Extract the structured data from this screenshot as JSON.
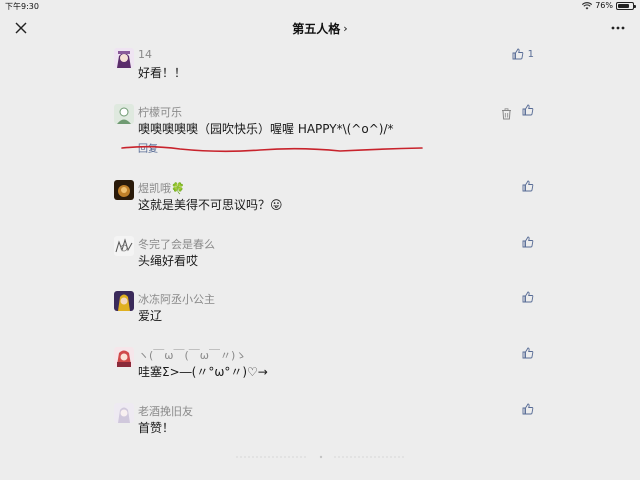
{
  "status": {
    "time": "下午9:30",
    "battery": "76%",
    "battery_level": 0.76
  },
  "nav": {
    "title": "第五人格",
    "chevron": "›",
    "close_icon": "close-icon",
    "more_icon": "more-icon"
  },
  "comments": [
    {
      "name": "14",
      "text": "好看！！",
      "likes": "1",
      "avatar_color": "#8a5a9a"
    },
    {
      "name": "柠檬可乐",
      "text": "噢噢噢噢噢（园吹快乐）喔喔 HAPPY*\\(^o^)/*",
      "reply": "回复",
      "avatar_color": "#6f9a72"
    },
    {
      "name": "煜凯哦🍀",
      "text": "这就是美得不可思议吗？😛",
      "avatar_color": "#7a4a1a"
    },
    {
      "name": "冬完了会是春么",
      "text": "头绳好看哎",
      "avatar_color": "#b8b8b8"
    },
    {
      "name": "冰冻阿丞小公主",
      "text": "爱辽",
      "avatar_color": "#c9a020"
    },
    {
      "name": "ヽ(￣ω￣(￣ω￣〃)ゝ",
      "text": "哇塞Σ>―(〃°ω°〃)♡→",
      "avatar_color": "#d04a4a"
    },
    {
      "name": "老酒挽旧友",
      "text": "首赞！",
      "avatar_color": "#d0c8dc"
    }
  ],
  "accent": "#576b95"
}
